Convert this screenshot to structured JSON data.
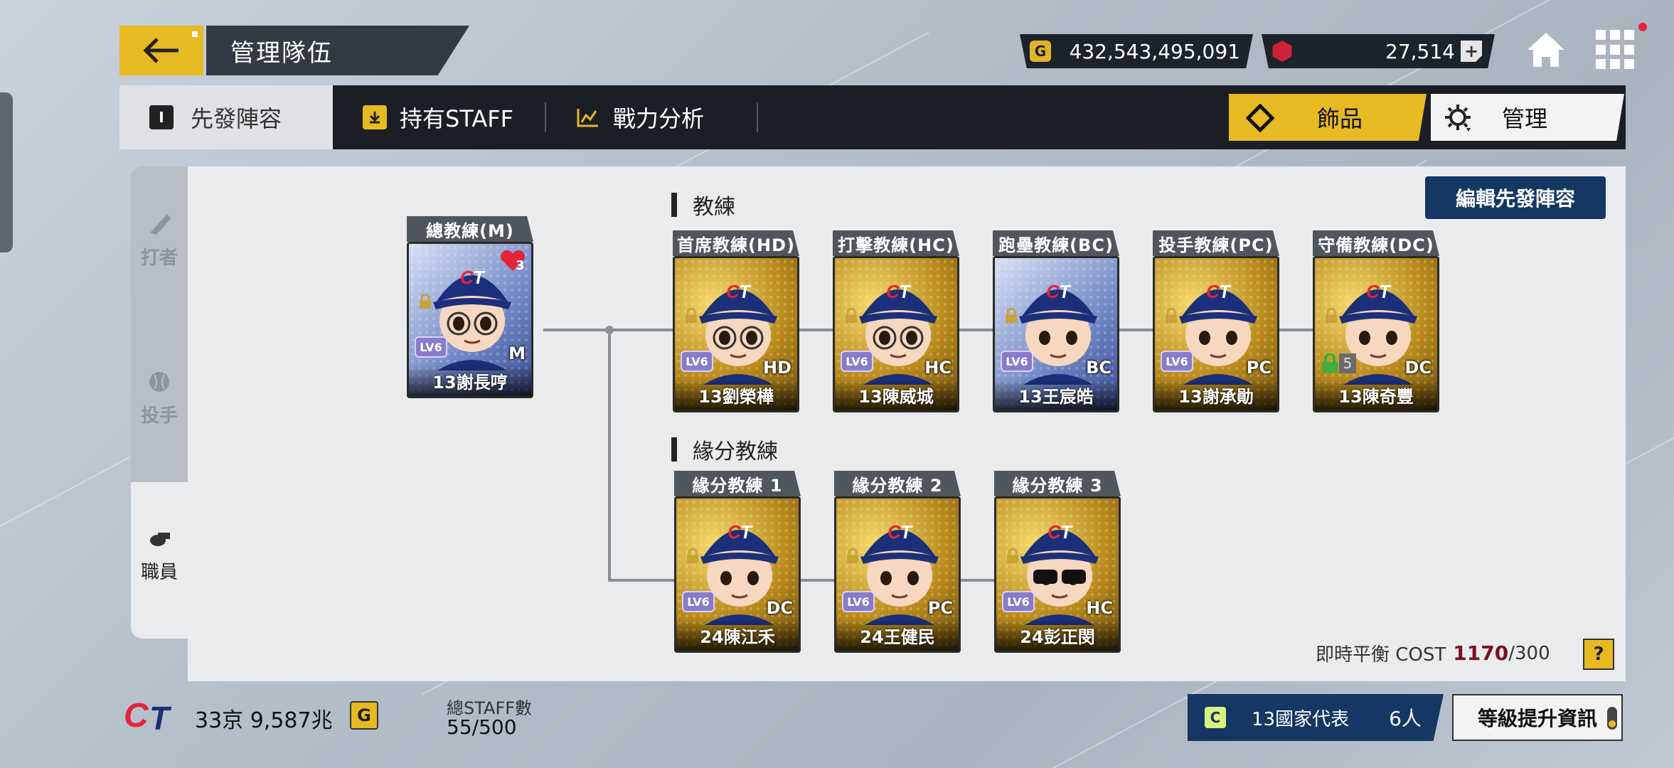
{
  "header": {
    "title": "管理隊伍",
    "gold": "432,543,495,091",
    "ruby": "27,514"
  },
  "tabs": {
    "lineup": "先發陣容",
    "staff": "持有STAFF",
    "analysis": "戰力分析",
    "accessory": "飾品",
    "manage": "管理"
  },
  "side": {
    "batter": "打者",
    "pitcher": "投手",
    "staff": "職員"
  },
  "sections": {
    "coaches": "教練",
    "bond": "緣分教練",
    "edit_button": "編輯先發陣容"
  },
  "manager": {
    "role": "總教練(M)",
    "level": "LV6",
    "pos": "M",
    "name": "13謝長哼",
    "hearts": "3"
  },
  "coaches": [
    {
      "role": "首席教練(HD)",
      "level": "LV6",
      "pos": "HD",
      "name": "13劉榮樺"
    },
    {
      "role": "打擊教練(HC)",
      "level": "LV6",
      "pos": "HC",
      "name": "13陳威城"
    },
    {
      "role": "跑壘教練(BC)",
      "level": "LV6",
      "pos": "BC",
      "name": "13王宸皓"
    },
    {
      "role": "投手教練(PC)",
      "level": "LV6",
      "pos": "PC",
      "name": "13謝承勛"
    },
    {
      "role": "守備教練(DC)",
      "level": "5",
      "pos": "DC",
      "name": "13陳奇豐"
    }
  ],
  "bond_coaches": [
    {
      "role": "緣分教練 1",
      "level": "LV6",
      "pos": "DC",
      "name": "24陳江禾"
    },
    {
      "role": "緣分教練 2",
      "level": "LV6",
      "pos": "PC",
      "name": "24王健民"
    },
    {
      "role": "緣分教練 3",
      "level": "LV6",
      "pos": "HC",
      "name": "24彭正閔"
    }
  ],
  "cost": {
    "label": "即時平衡 COST",
    "current": "1170",
    "max": "/300",
    "help": "?"
  },
  "footer": {
    "funds": "33京 9,587兆",
    "funds_icon": "G",
    "staff_label": "總STAFF數",
    "staff_value": "55/500",
    "national_label": "13國家代表",
    "national_count": "6人",
    "national_icon": "C",
    "upgrade": "等級提升資訊"
  },
  "icons": {
    "coin": "G",
    "tab_lineup": "I"
  },
  "colors": {
    "accent": "#e7b923",
    "navy": "#153763",
    "dark": "#1b1f25"
  }
}
